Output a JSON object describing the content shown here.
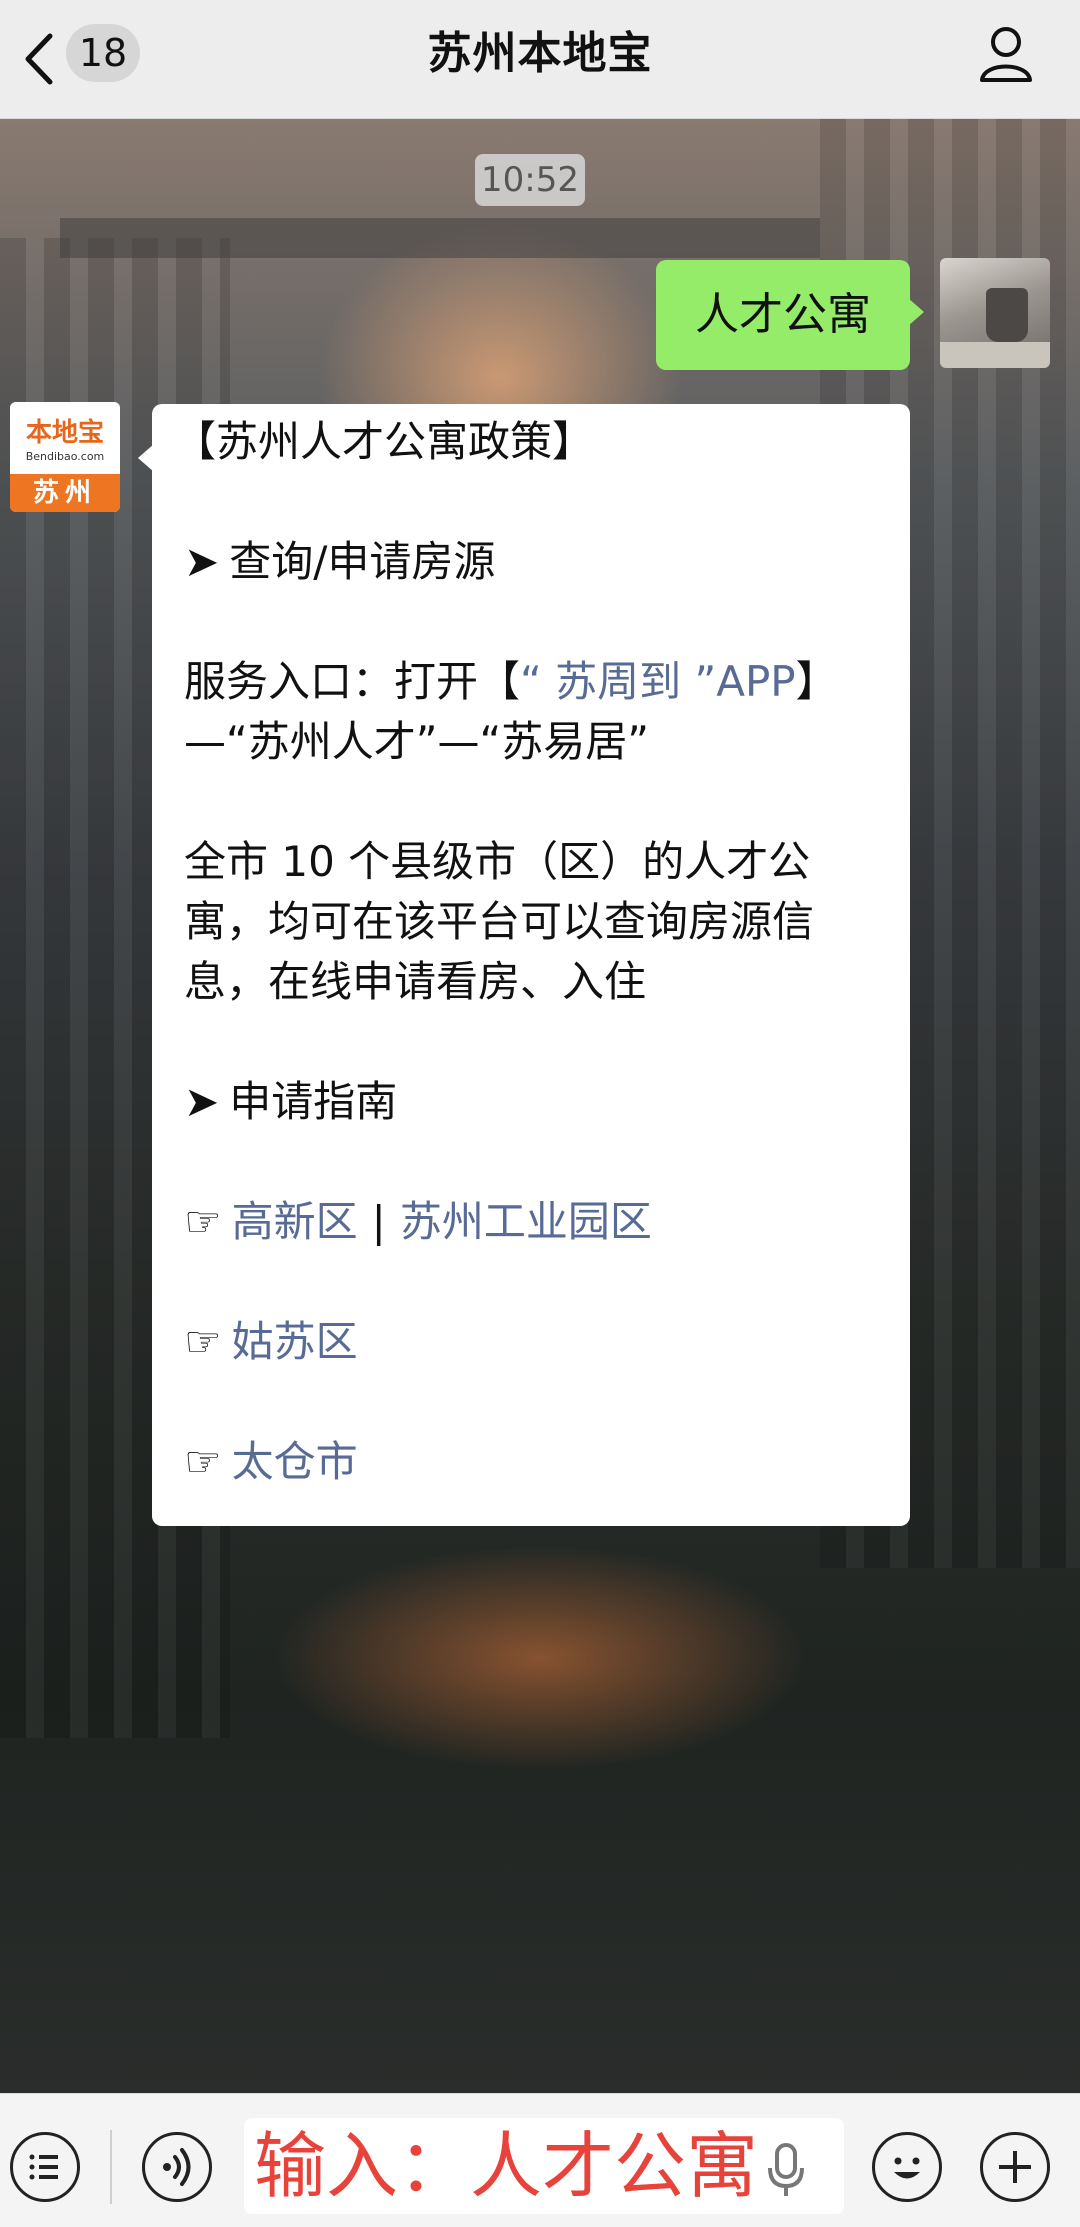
{
  "header": {
    "unread_count": "18",
    "title": "苏州本地宝"
  },
  "chat": {
    "timestamp": "10:52",
    "sent_message": "人才公寓",
    "bot_avatar": {
      "brand": "本地宝",
      "url": "Bendibao.com",
      "city": "苏州"
    },
    "reply": {
      "heading": "【苏州人才公寓政策】",
      "section1_arrow": "➤",
      "section1_title": "查询/申请房源",
      "service_prefix": "服务入口：打开【",
      "service_link": "“ 苏周到 ”APP",
      "service_suffix": "】",
      "service_line2": "—“苏州人才”—“苏易居”",
      "desc_line1": "全市 10 个县级市（区）的人才公",
      "desc_line2": "寓，均可在该平台可以查询房源信",
      "desc_line3": "息，在线申请看房、入住",
      "section2_arrow": "➤",
      "section2_title": "申请指南",
      "hand": "☞",
      "link1": "高新区",
      "sep": "|",
      "link2": "苏州工业园区",
      "link3": "姑苏区",
      "link4": "太仓市"
    }
  },
  "input": {
    "text": "输入：人才公寓"
  },
  "colors": {
    "sent_bubble": "#95ec69",
    "link": "#576b95",
    "input_text": "#e8433b",
    "brand_orange": "#ee7623"
  }
}
